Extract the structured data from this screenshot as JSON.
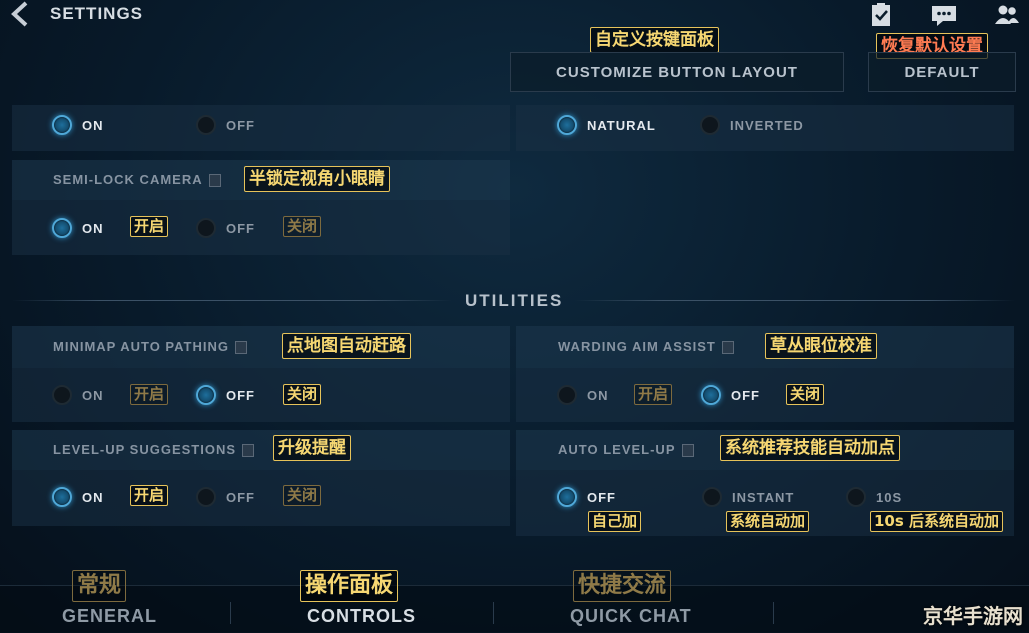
{
  "header": {
    "title": "SETTINGS",
    "customize_label": "CUSTOMIZE BUTTON LAYOUT",
    "customize_note": "自定义按键面板",
    "default_label": "DEFAULT",
    "default_note": "恢复默认设置"
  },
  "top_partial": {
    "left": {
      "on": "ON",
      "off": "OFF"
    },
    "right": {
      "natural": "NATURAL",
      "inverted": "INVERTED"
    }
  },
  "semi_lock": {
    "label": "SEMI-LOCK CAMERA",
    "note": "半锁定视角小眼睛",
    "on": "ON",
    "on_note": "开启",
    "off": "OFF",
    "off_note": "关闭"
  },
  "utilities": {
    "title": "UTILITIES",
    "minimap": {
      "label": "MINIMAP AUTO PATHING",
      "note": "点地图自动赶路",
      "on": "ON",
      "on_note": "开启",
      "off": "OFF",
      "off_note": "关闭"
    },
    "warding": {
      "label": "WARDING AIM ASSIST",
      "note": "草丛眼位校准",
      "on": "ON",
      "on_note": "开启",
      "off": "OFF",
      "off_note": "关闭"
    },
    "levelup_sugg": {
      "label": "LEVEL-UP SUGGESTIONS",
      "note": "升级提醒",
      "on": "ON",
      "on_note": "开启",
      "off": "OFF",
      "off_note": "关闭"
    },
    "auto_levelup": {
      "label": "AUTO LEVEL-UP",
      "note": "系统推荐技能自动加点",
      "off": "OFF",
      "off_note": "自己加",
      "instant": "INSTANT",
      "instant_note": "系统自动加",
      "ten": "10S",
      "ten_note": "10s 后系统自动加"
    }
  },
  "tabs": {
    "general": "GENERAL",
    "general_note": "常规",
    "controls": "CONTROLS",
    "controls_note": "操作面板",
    "quick_chat": "QUICK CHAT",
    "quick_chat_note": "快捷交流"
  },
  "watermark": "京华手游网",
  "colors": {
    "accent": "#4fa8d8",
    "note_border": "#e6c35a",
    "note_text": "#f6d772",
    "note_red": "#ff7b52"
  },
  "icons": [
    "back-chevron-icon",
    "checklist-icon",
    "chat-icon",
    "friends-icon",
    "info-icon"
  ]
}
